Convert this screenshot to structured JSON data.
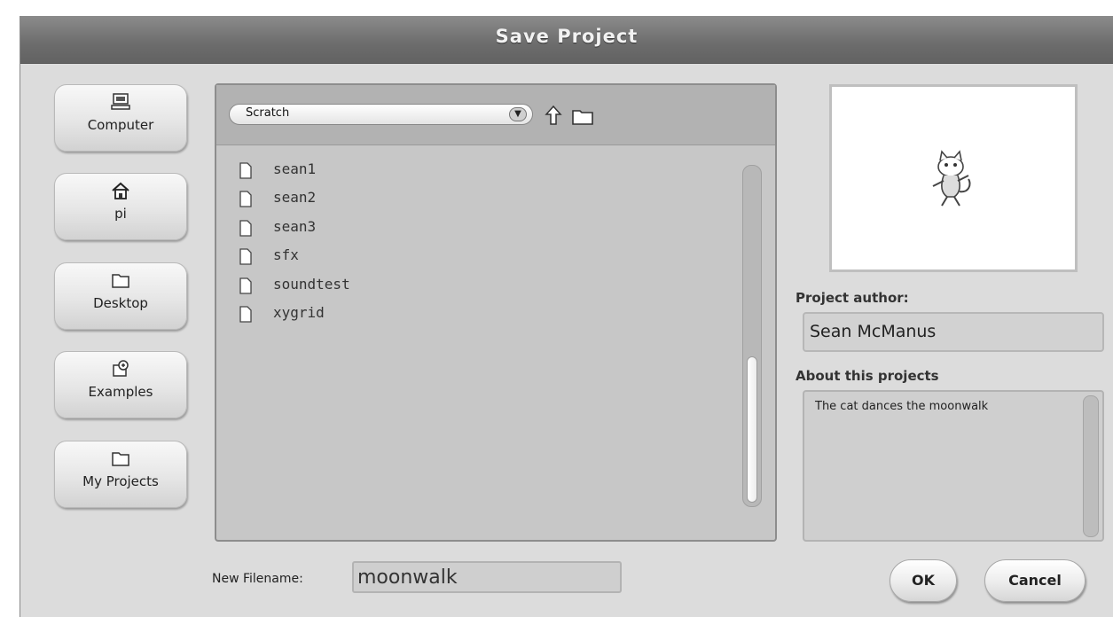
{
  "dialog": {
    "title": "Save Project"
  },
  "locations": [
    {
      "label": "Computer",
      "icon": "computer-icon"
    },
    {
      "label": "pi",
      "icon": "home-icon"
    },
    {
      "label": "Desktop",
      "icon": "folder-icon"
    },
    {
      "label": "Examples",
      "icon": "examples-icon"
    },
    {
      "label": "My Projects",
      "icon": "folder-icon"
    }
  ],
  "browser": {
    "current_folder": "Scratch",
    "files": [
      "sean1",
      "sean2",
      "sean3",
      "sfx",
      "soundtest",
      "xygrid"
    ]
  },
  "author": {
    "label": "Project author:",
    "value": "Sean McManus"
  },
  "about": {
    "label": "About this projects",
    "value": "The cat dances the moonwalk"
  },
  "filename": {
    "label": "New Filename:",
    "value": "moonwalk"
  },
  "buttons": {
    "ok": "OK",
    "cancel": "Cancel"
  }
}
